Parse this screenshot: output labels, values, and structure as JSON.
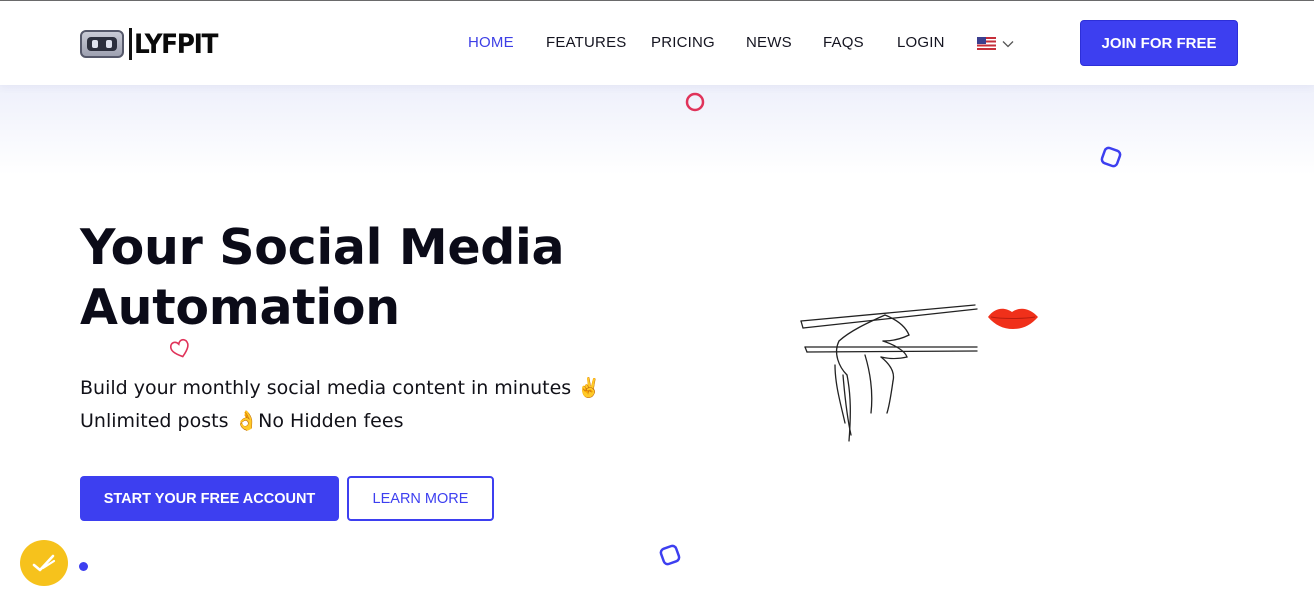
{
  "brand": {
    "name": "LYFPIT"
  },
  "nav": {
    "items": [
      {
        "label": "HOME",
        "active": true
      },
      {
        "label": "FEATURES",
        "active": false
      },
      {
        "label": "PRICING",
        "active": false
      },
      {
        "label": "NEWS",
        "active": false
      },
      {
        "label": "FAQS",
        "active": false
      },
      {
        "label": "LOGIN",
        "active": false
      }
    ],
    "language": {
      "icon": "us-flag-icon",
      "chevron": "chevron-down-icon"
    },
    "cta_label": "JOIN FOR FREE"
  },
  "hero": {
    "title_line1": "Your Social Media",
    "title_line2": "Automation",
    "subtitle_line1": "Build your monthly social media content in minutes ✌️",
    "subtitle_line2": "Unlimited posts 👌No Hidden fees",
    "primary_button": "START YOUR FREE ACCOUNT",
    "secondary_button": "LEARN MORE"
  },
  "colors": {
    "accent": "#3d3ff0",
    "decor_red": "#e0335a",
    "lips": "#f0301a",
    "widget": "#f6c21c"
  }
}
